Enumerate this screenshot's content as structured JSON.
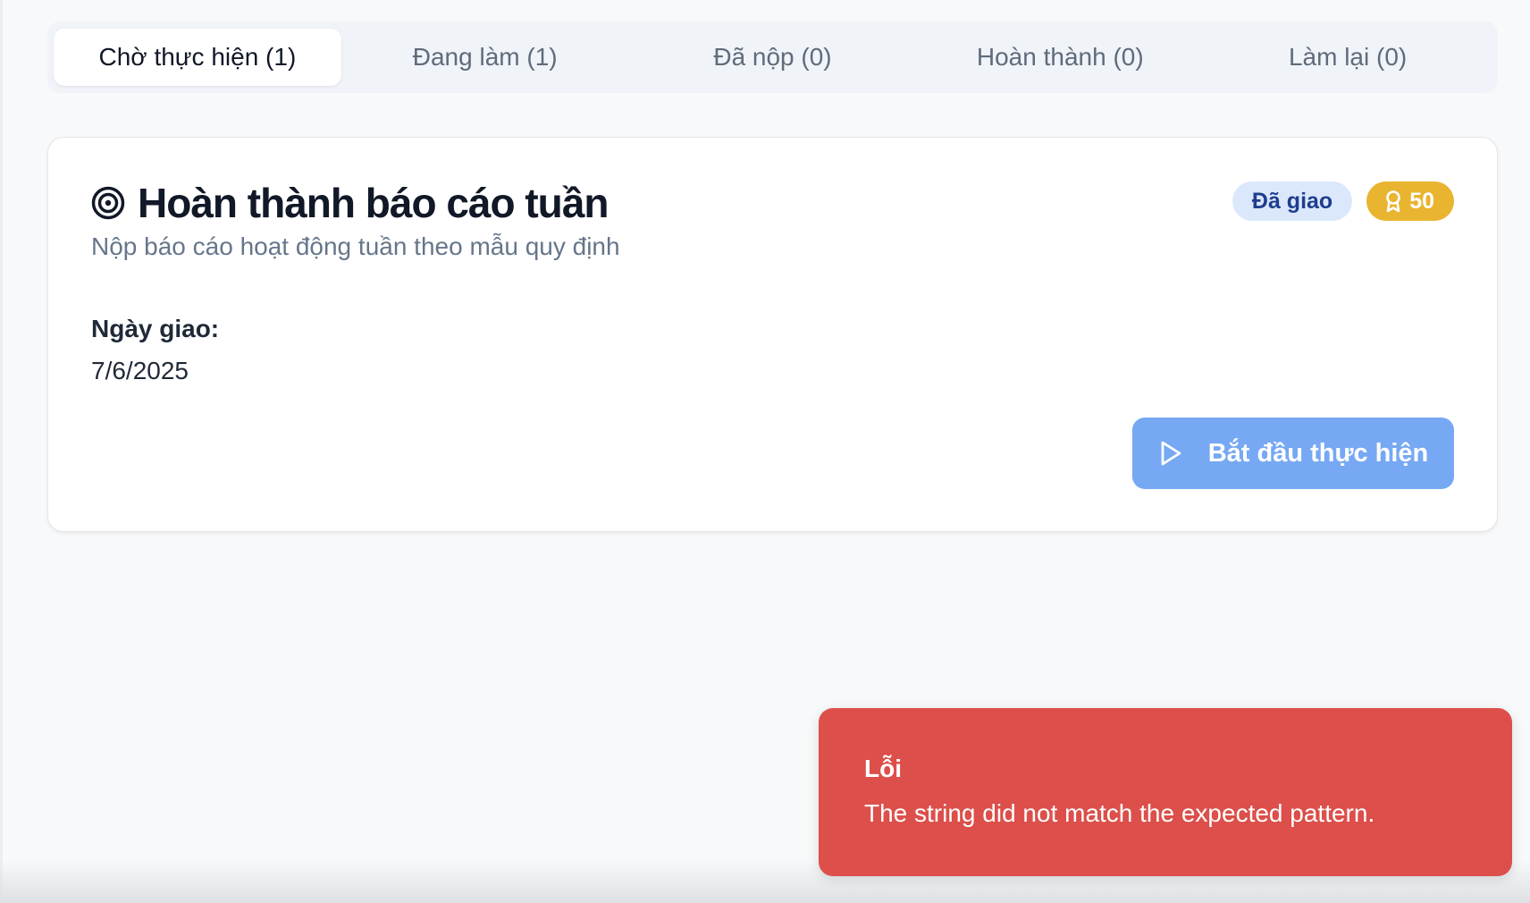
{
  "tabs": [
    {
      "label": "Chờ thực hiện (1)",
      "active": true
    },
    {
      "label": "Đang làm (1)",
      "active": false
    },
    {
      "label": "Đã nộp (0)",
      "active": false
    },
    {
      "label": "Hoàn thành (0)",
      "active": false
    },
    {
      "label": "Làm lại (0)",
      "active": false
    }
  ],
  "task": {
    "icon": "target-icon",
    "title": "Hoàn thành báo cáo tuần",
    "description": "Nộp báo cáo hoạt động tuần theo mẫu quy định",
    "status_badge": "Đã giao",
    "points_icon": "award-icon",
    "points": "50",
    "assigned_label": "Ngày giao:",
    "assigned_date": "7/6/2025",
    "start_button_icon": "play-icon",
    "start_button_label": "Bắt đầu thực hiện"
  },
  "toast": {
    "title": "Lỗi",
    "message": "The string did not match the expected pattern."
  },
  "colors": {
    "accent_button": "#76a8f3",
    "status_badge_bg": "#dbe8fb",
    "points_badge_bg": "#e9b42f",
    "toast_error_bg": "#dc4f4a"
  }
}
